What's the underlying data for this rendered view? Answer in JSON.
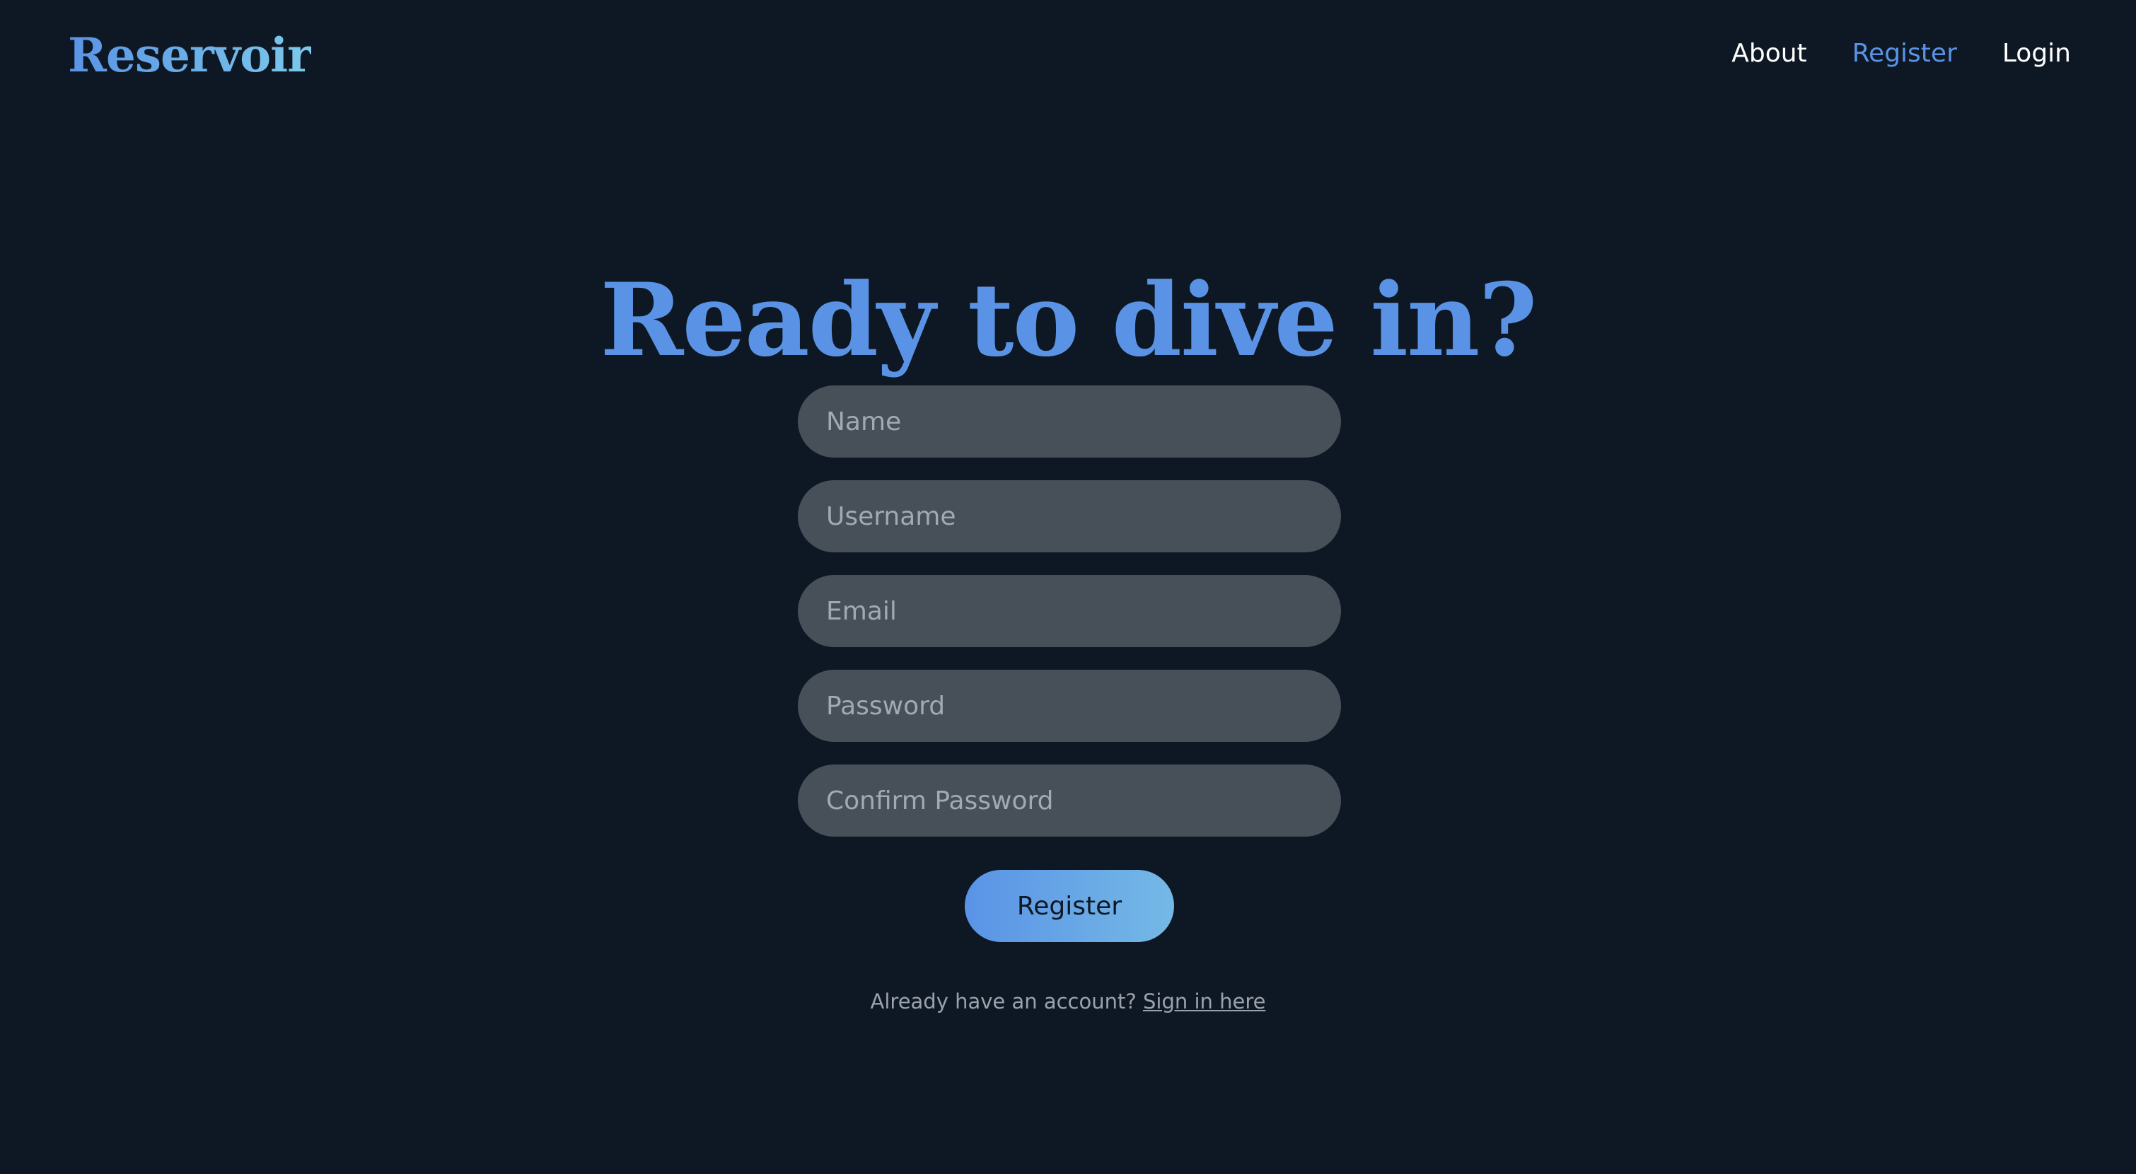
{
  "app": {
    "logo_text": "Reservoir",
    "colors": {
      "background": "#0e1824",
      "accent": "#5a93e6",
      "accent_light": "#7cc9ea",
      "input_bg": "#474f59",
      "muted_text": "#9aa1ab"
    }
  },
  "nav": {
    "items": [
      {
        "label": "About",
        "active": false
      },
      {
        "label": "Register",
        "active": true
      },
      {
        "label": "Login",
        "active": false
      }
    ]
  },
  "main": {
    "headline": "Ready to dive in?",
    "form": {
      "fields": [
        {
          "placeholder": "Name",
          "value": ""
        },
        {
          "placeholder": "Username",
          "value": ""
        },
        {
          "placeholder": "Email",
          "value": ""
        },
        {
          "placeholder": "Password",
          "value": ""
        },
        {
          "placeholder": "Confirm Password",
          "value": ""
        }
      ],
      "submit_label": "Register"
    },
    "footer": {
      "prompt": "Already have an account? ",
      "link_label": "Sign in here"
    }
  }
}
